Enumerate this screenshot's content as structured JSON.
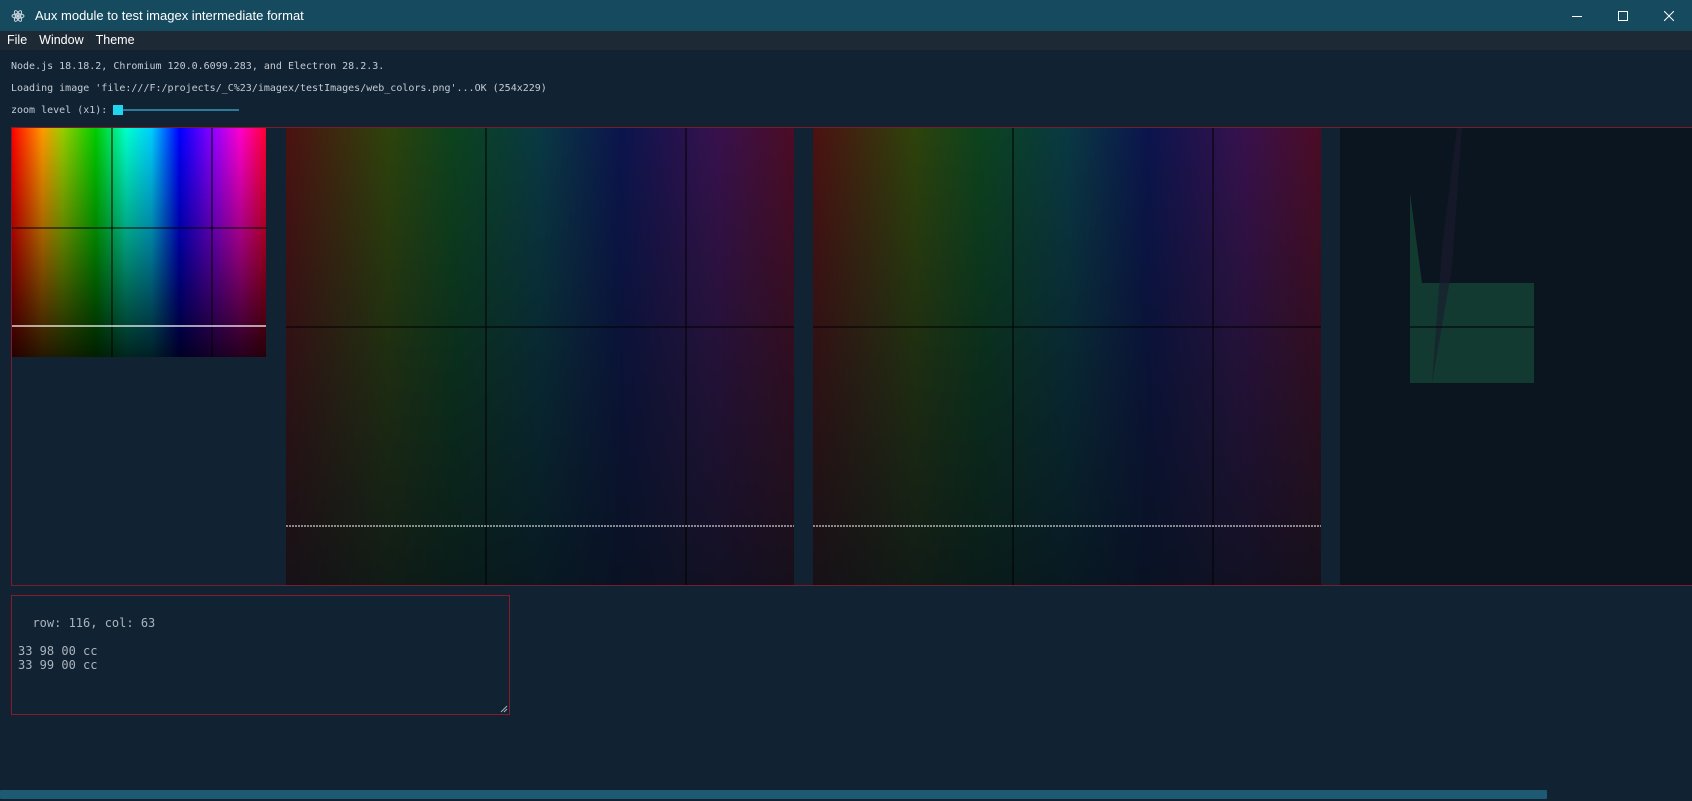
{
  "window": {
    "title": "Aux module to test imagex intermediate format",
    "icon": "electron-icon",
    "controls": [
      "minimize-icon",
      "maximize-icon",
      "close-icon"
    ]
  },
  "menu": {
    "items": [
      "File",
      "Window",
      "Theme"
    ]
  },
  "info": {
    "versions": "Node.js 18.18.2, Chromium 120.0.6099.283, and Electron 28.2.3.",
    "loading": "Loading image 'file:///F:/projects/_C%23/imagex/testImages/web_colors.png'...OK (254x229)",
    "zoom_label": "zoom level (x1):",
    "zoom_value": 1
  },
  "output": {
    "text": "row: 116, col: 63\n\n33 98 00 cc\n33 99 00 cc"
  },
  "colors": {
    "background": "#112233",
    "titlebar": "#164a5f",
    "accent": "#1fd6f0",
    "border": "#7a1c2c"
  }
}
